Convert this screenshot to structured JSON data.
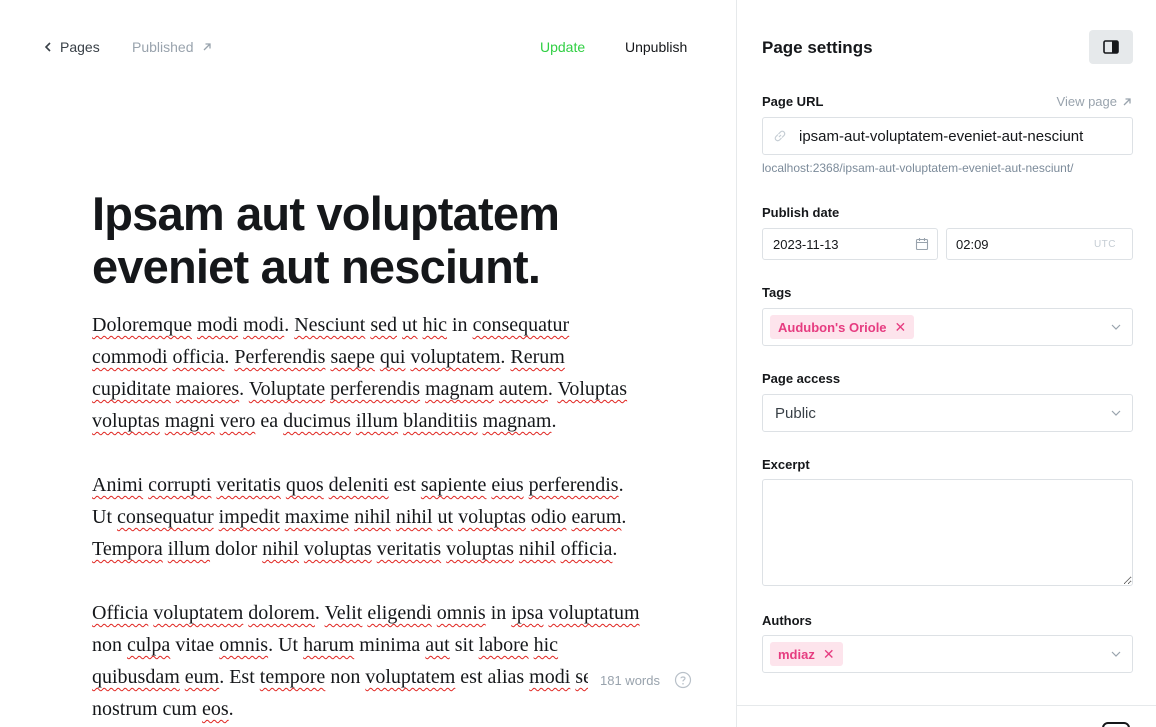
{
  "editor": {
    "back_label": "Pages",
    "status_label": "Published",
    "update_label": "Update",
    "unpublish_label": "Unpublish",
    "title_line1": "Ipsam aut voluptatem",
    "title_line2": "eveniet aut nesciunt.",
    "word_count": "181 words"
  },
  "settings": {
    "title": "Page settings",
    "page_url_label": "Page URL",
    "view_page_label": "View page",
    "slug": "ipsam-aut-voluptatem-eveniet-aut-nesciunt",
    "url_preview": "localhost:2368/ipsam-aut-voluptatem-eveniet-aut-nesciunt/",
    "publish_date_label": "Publish date",
    "date_value": "2023-11-13",
    "time_value": "02:09",
    "timezone": "UTC",
    "tags_label": "Tags",
    "tag": "Audubon's Oriole",
    "page_access_label": "Page access",
    "page_access_value": "Public",
    "excerpt_label": "Excerpt",
    "excerpt_value": "",
    "authors_label": "Authors",
    "author": "mdiaz"
  },
  "colors": {
    "accent_green": "#30cf43",
    "tag_pink": "#e63c80",
    "tag_bg": "#fde4ec"
  },
  "icons": [
    "chevron-left-icon",
    "arrow-up-right-icon",
    "help-icon",
    "sidebar-toggle-icon",
    "link-icon",
    "calendar-icon",
    "chevron-down-icon",
    "close-icon"
  ]
}
